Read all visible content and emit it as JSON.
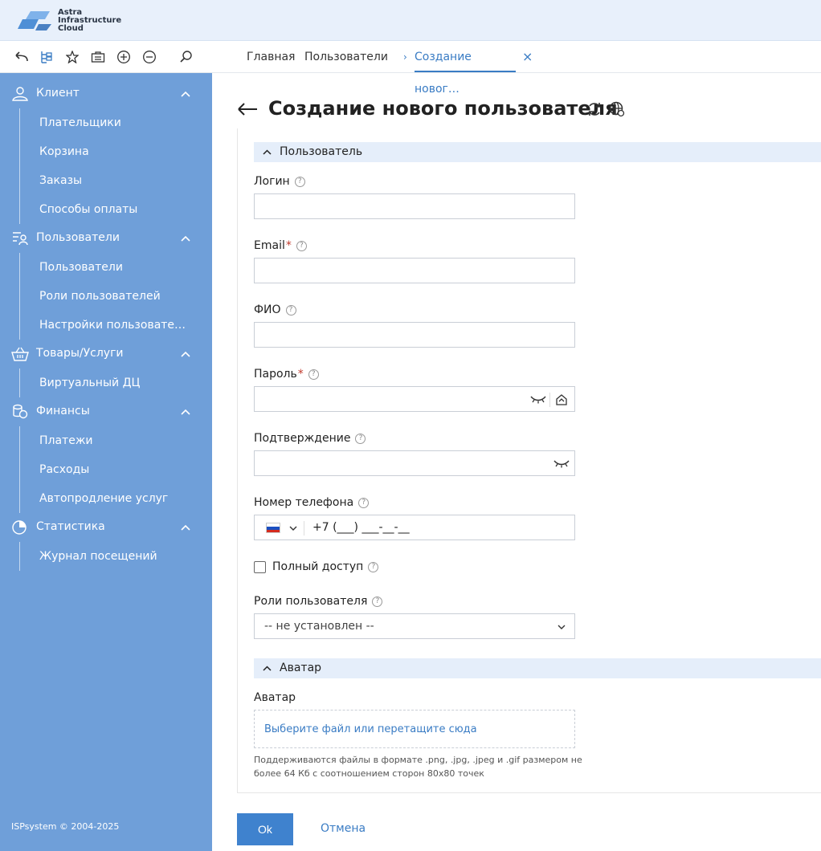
{
  "brand": {
    "line1": "Astra",
    "line2": "Infrastructure",
    "line3": "Cloud"
  },
  "toolbar": {
    "icons": [
      "back-icon",
      "tree-icon",
      "star-icon",
      "briefcase-icon",
      "zoom-in-icon",
      "zoom-out-icon",
      "search-icon"
    ]
  },
  "tabs": [
    {
      "label": "Главная"
    },
    {
      "label": "Пользователи"
    },
    {
      "label": "Создание новог…",
      "active": true
    }
  ],
  "tab_close": "×",
  "sidebar": {
    "groups": [
      {
        "label": "Клиент",
        "icon": "user-icon",
        "items": [
          "Плательщики",
          "Корзина",
          "Заказы",
          "Способы оплаты"
        ]
      },
      {
        "label": "Пользователи",
        "icon": "users-list-icon",
        "items": [
          "Пользователи",
          "Роли пользователей",
          "Настройки пользовате…"
        ]
      },
      {
        "label": "Товары/Услуги",
        "icon": "basket-icon",
        "items": [
          "Виртуальный ДЦ"
        ]
      },
      {
        "label": "Финансы",
        "icon": "coins-icon",
        "items": [
          "Платежи",
          "Расходы",
          "Автопродление услуг"
        ]
      },
      {
        "label": "Статистика",
        "icon": "pie-chart-icon",
        "items": [
          "Журнал посещений"
        ]
      }
    ],
    "copyright": "ISPsystem © 2004-2025"
  },
  "page": {
    "title": "Создание нового пользователя"
  },
  "form": {
    "section_user": "Пользователь",
    "login_label": "Логин",
    "email_label": "Email",
    "fio_label": "ФИО",
    "password_label": "Пароль",
    "confirm_label": "Подтверждение",
    "phone_label": "Номер телефона",
    "phone_value": "+7 (___) ___-__-__",
    "full_access_label": "Полный доступ",
    "roles_label": "Роли пользователя",
    "roles_value": "-- не установлен --",
    "section_avatar": "Аватар",
    "avatar_label": "Аватар",
    "avatar_drop": "Выберите файл или перетащите сюда",
    "avatar_hint": "Поддерживаются файлы в формате .png, .jpg, .jpeg и .gif размером не более 64 Кб с соотношением сторон 80x80 точек",
    "required_mark": "*",
    "help_mark": "?"
  },
  "actions": {
    "ok": "Ok",
    "cancel": "Отмена"
  },
  "colors": {
    "sidebar": "#6f9fd9",
    "accent": "#3a7cc4",
    "section": "#e5eefa",
    "header": "#e8f0fb"
  }
}
